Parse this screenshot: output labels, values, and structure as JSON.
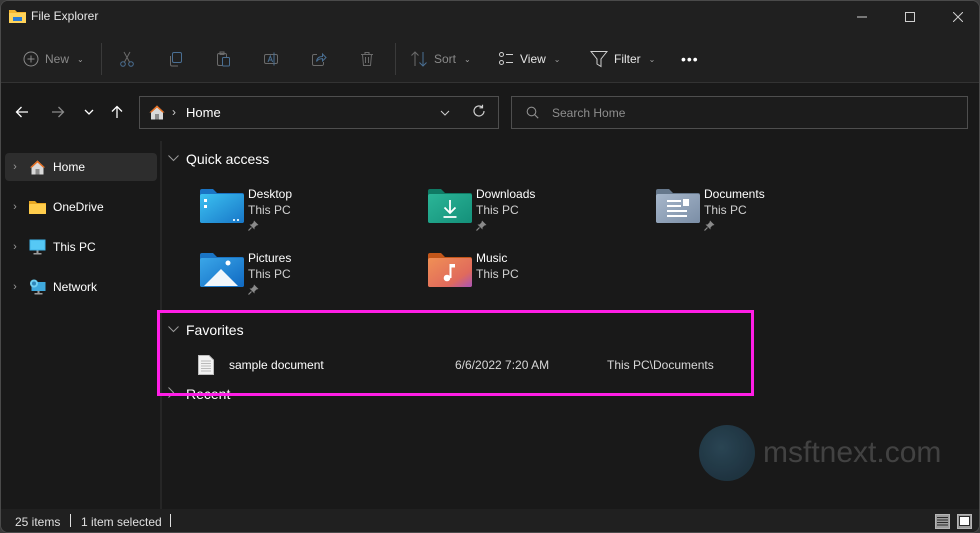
{
  "window": {
    "title": "File Explorer",
    "controls": {
      "minimize": "minimize",
      "maximize": "maximize",
      "close": "close"
    }
  },
  "toolbar": {
    "new_label": "New",
    "sort_label": "Sort",
    "view_label": "View",
    "filter_label": "Filter",
    "more_label": "•••",
    "icons": [
      "plus-circle-icon",
      "cut-icon",
      "copy-icon",
      "paste-icon",
      "rename-icon",
      "share-icon",
      "delete-icon",
      "sort-icon",
      "view-icon",
      "filter-icon",
      "more-icon"
    ]
  },
  "navigation": {
    "breadcrumb_separator": "›",
    "breadcrumb": [
      "Home"
    ]
  },
  "search": {
    "placeholder": "Search Home",
    "value": ""
  },
  "sidebar": {
    "items": [
      {
        "label": "Home",
        "icon": "home-icon",
        "active": true
      },
      {
        "label": "OneDrive",
        "icon": "onedrive-folder-icon",
        "active": false
      },
      {
        "label": "This PC",
        "icon": "this-pc-icon",
        "active": false
      },
      {
        "label": "Network",
        "icon": "network-icon",
        "active": false
      }
    ]
  },
  "quick_access": {
    "title": "Quick access",
    "items": [
      {
        "name": "Desktop",
        "location": "This PC",
        "pinned": true,
        "icon": "desktop-folder-icon"
      },
      {
        "name": "Downloads",
        "location": "This PC",
        "pinned": true,
        "icon": "downloads-folder-icon"
      },
      {
        "name": "Documents",
        "location": "This PC",
        "pinned": true,
        "icon": "documents-folder-icon"
      },
      {
        "name": "Pictures",
        "location": "This PC",
        "pinned": true,
        "icon": "pictures-folder-icon"
      },
      {
        "name": "Music",
        "location": "This PC",
        "pinned": false,
        "icon": "music-folder-icon"
      }
    ]
  },
  "favorites": {
    "title": "Favorites",
    "items": [
      {
        "name": "sample document",
        "date": "6/6/2022 7:20 AM",
        "location": "This PC\\Documents"
      }
    ]
  },
  "recent": {
    "title": "Recent"
  },
  "watermark": {
    "text": "msftnext.com"
  },
  "statusbar": {
    "item_count": "25 items",
    "selection": "1 item selected"
  },
  "colors": {
    "highlight": "#ff1ee6",
    "background": "#191919",
    "chrome": "#202020"
  }
}
